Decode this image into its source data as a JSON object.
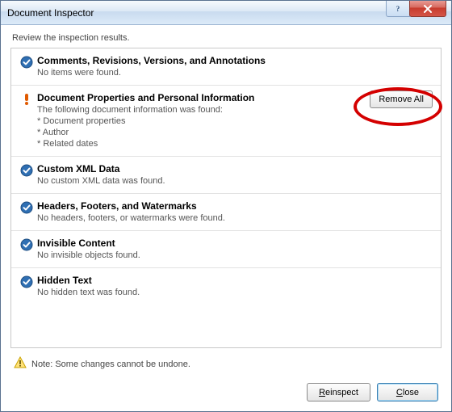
{
  "window": {
    "title": "Document Inspector"
  },
  "review_label": "Review the inspection results.",
  "sections": [
    {
      "status": "ok",
      "heading": "Comments, Revisions, Versions, and Annotations",
      "desc": "No items were found."
    },
    {
      "status": "warn",
      "heading": "Document Properties and Personal Information",
      "desc": "The following document information was found:",
      "details": [
        "* Document properties",
        "* Author",
        "* Related dates"
      ],
      "action_label": "Remove All"
    },
    {
      "status": "ok",
      "heading": "Custom XML Data",
      "desc": "No custom XML data was found."
    },
    {
      "status": "ok",
      "heading": "Headers, Footers, and Watermarks",
      "desc": "No headers, footers, or watermarks were found."
    },
    {
      "status": "ok",
      "heading": "Invisible Content",
      "desc": "No invisible objects found."
    },
    {
      "status": "ok",
      "heading": "Hidden Text",
      "desc": "No hidden text was found."
    }
  ],
  "footer_note": "Note: Some changes cannot be undone.",
  "buttons": {
    "reinspect_prefix": "R",
    "reinspect_rest": "einspect",
    "close_prefix": "C",
    "close_rest": "lose"
  }
}
